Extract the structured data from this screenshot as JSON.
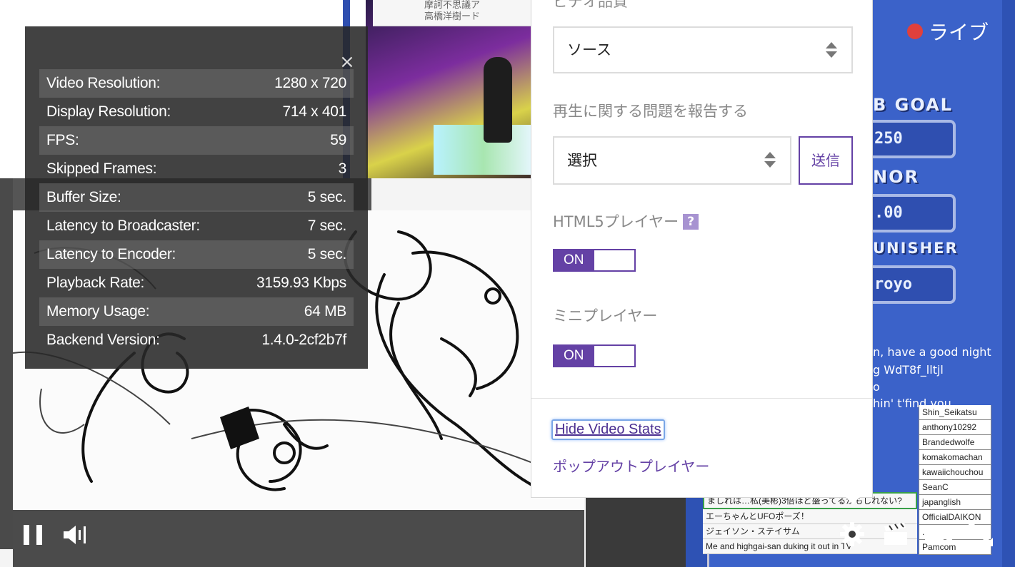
{
  "background": {
    "cam_header_line1": "摩訶不思議ア",
    "cam_header_line2": "高橋洋樹ード",
    "overlay_texts": [
      "B GOAL",
      "250",
      "NOR",
      ".00",
      "UNISHER",
      "royo"
    ],
    "chat_lines": [
      "n, have a good night",
      "g WdT8f_lltjl",
      "o",
      "hin' t'find you"
    ],
    "name_list": [
      "Shin_Seikatsu",
      "anthony10292",
      "Brandedwolfe",
      "komakomachan",
      "kawaiichouchou",
      "SeanC",
      "japanglish",
      "OfficialDAIKON",
      "..._tv",
      "Pamcom"
    ],
    "chat_messages": [
      "ましれは…私(美彬)3倍ほど盛ってるかもしれない?",
      "エーちゃんとUFOポーズ！",
      "ジェイソン・ステイサム",
      "Me and highgai-san duking it out in TV"
    ],
    "live_label": "ライブ",
    "live_dot_color": "#e0403c"
  },
  "stats": {
    "close_icon": "close-icon",
    "rows": [
      {
        "label": "Video Resolution:",
        "value": "1280 x 720"
      },
      {
        "label": "Display Resolution:",
        "value": "714 x 401"
      },
      {
        "label": "FPS:",
        "value": "59"
      },
      {
        "label": "Skipped Frames:",
        "value": "3"
      },
      {
        "label": "Buffer Size:",
        "value": "5 sec."
      },
      {
        "label": "Latency to Broadcaster:",
        "value": "7 sec."
      },
      {
        "label": "Latency to Encoder:",
        "value": "5 sec."
      },
      {
        "label": "Playback Rate:",
        "value": "3159.93 Kbps"
      },
      {
        "label": "Memory Usage:",
        "value": "64 MB"
      },
      {
        "label": "Backend Version:",
        "value": "1.4.0-2cf2b7f"
      }
    ]
  },
  "settings": {
    "quality_label": "ビデオ品質",
    "quality_value": "ソース",
    "report_label": "再生に関する問題を報告する",
    "report_value": "選択",
    "send_label": "送信",
    "html5_label": "HTML5プレイヤー",
    "help_mark": "?",
    "html5_toggle": "ON",
    "mini_label": "ミニプレイヤー",
    "mini_toggle": "ON",
    "hide_stats_link": "Hide Video Stats",
    "popout_link": "ポップアウトプレイヤー",
    "accent_color": "#6441a5"
  },
  "controls": {
    "icons": [
      "pause-icon",
      "volume-icon",
      "gear-icon",
      "clapperboard-icon",
      "theater-mode-icon",
      "fullscreen-icon"
    ]
  }
}
